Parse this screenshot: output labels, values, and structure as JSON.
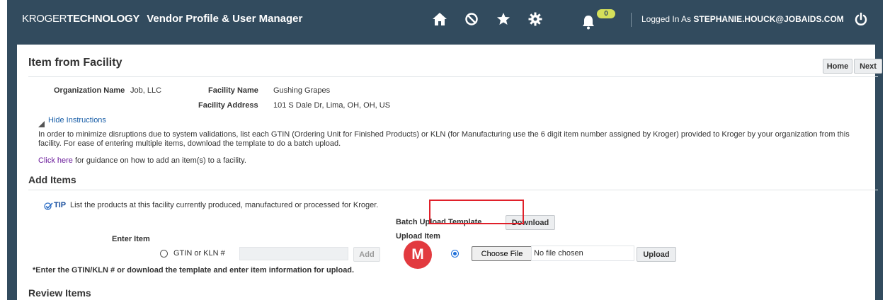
{
  "header": {
    "brand_kroger": "KROGER",
    "brand_technology": "TECHNOLOGY",
    "title": "Vendor Profile & User Manager",
    "icons": [
      "home-icon",
      "block-icon",
      "star-icon",
      "gear-icon",
      "bell-icon",
      "power-icon"
    ],
    "notification_count": "0",
    "logged_prefix": "Logged In As",
    "logged_user": "STEPHANIE.HOUCK@JOBAIDS.COM"
  },
  "page": {
    "title": "Item from Facility",
    "home_label": "Home",
    "next_label": "Next"
  },
  "org": {
    "org_name_label": "Organization Name",
    "org_name_value": "Job, LLC",
    "facility_name_label": "Facility Name",
    "facility_name_value": "Gushing Grapes",
    "facility_address_label": "Facility Address",
    "facility_address_value": "101 S Dale Dr, Lima, OH, OH, US"
  },
  "instructions": {
    "toggle_label": "Hide Instructions",
    "text": "In order to minimize disruptions due to system validations, list each GTIN (Ordering Unit for Finished Products) or KLN (for Manufacturing use the 6 digit item number assigned by Kroger) provided to Kroger by your organization from this facility. For ease of entering multiple items, download the template to do a batch upload.",
    "click_here": "Click here",
    "click_here_suffix": " for guidance on how to add an item(s) to a facility."
  },
  "add_items": {
    "heading": "Add Items",
    "tip_label": "TIP",
    "tip_text": "List the products at this facility currently produced, manufactured or processed for Kroger.",
    "batch_template_label": "Batch Upload Template",
    "download_label": "Download",
    "enter_item_label": "Enter Item",
    "upload_item_label": "Upload Item",
    "gtin_label": "GTIN or KLN #",
    "add_label": "Add",
    "choose_file_label": "Choose File",
    "no_file_label": "No file chosen",
    "upload_label": "Upload",
    "note": "*Enter the GTIN/KLN # or download the template and enter item information for upload.",
    "gtin_selected": false,
    "upload_selected": true
  },
  "review_items": {
    "heading": "Review Items"
  },
  "annotation": {
    "marker_letter": "M",
    "marker_color": "#e23a3f",
    "highlight_color": "#e0202a"
  },
  "colors": {
    "header_bg": "#324b5e",
    "link": "#1a5fa8",
    "badge": "#d5e05a"
  }
}
